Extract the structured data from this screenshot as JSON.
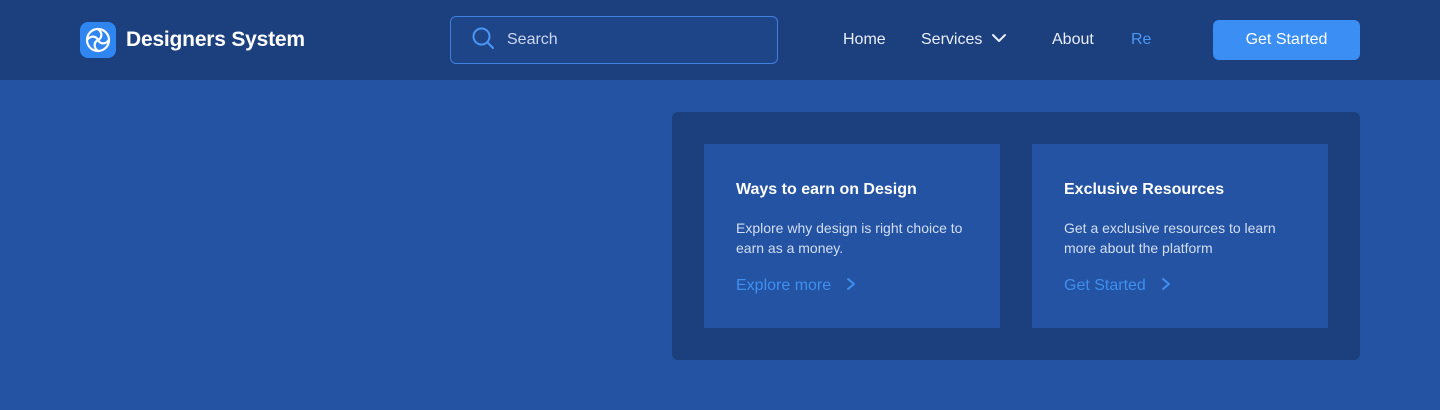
{
  "brand": {
    "name": "Designers System",
    "logo_icon": "aperture-icon"
  },
  "search": {
    "placeholder": "Search",
    "icon": "search-icon"
  },
  "nav": {
    "home": "Home",
    "services": "Services",
    "about": "About",
    "resources_partial": "Re",
    "active_item": "Re"
  },
  "cta": {
    "label": "Get Started"
  },
  "dropdown": {
    "cards": [
      {
        "title": "Ways to earn on Design",
        "description": "Explore why design is right choice to earn as a money.",
        "link_label": "Explore more",
        "link_icon": "chevron-right-icon"
      },
      {
        "title": "Exclusive Resources",
        "description": "Get a exclusive resources to learn more about the platform",
        "link_label": "Get Started",
        "link_icon": "chevron-right-icon"
      }
    ]
  },
  "colors": {
    "background": "#2353a2",
    "navbar": "#1c3f7e",
    "accent": "#3b8ef4",
    "link": "#3f8ff0"
  }
}
